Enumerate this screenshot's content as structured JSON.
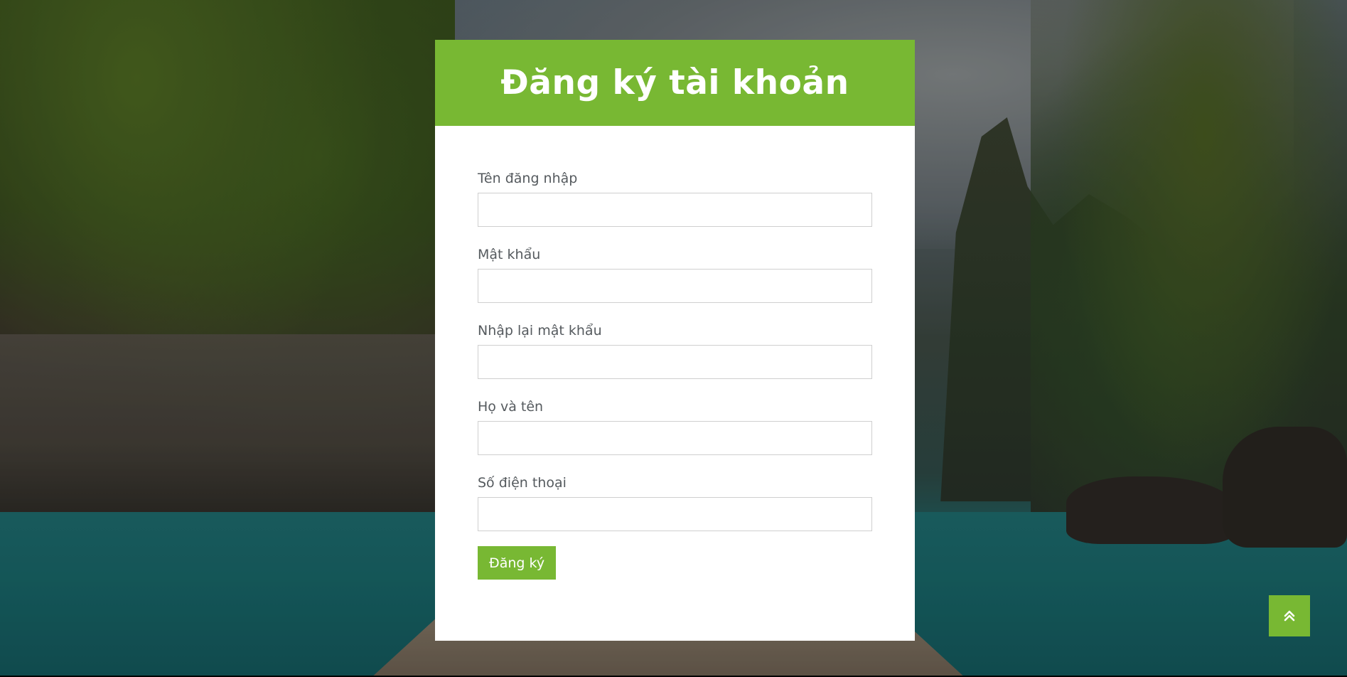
{
  "page": {
    "title": "Đăng ký tài khoản"
  },
  "form": {
    "fields": [
      {
        "label": "Tên đăng nhập",
        "value": "",
        "placeholder": ""
      },
      {
        "label": "Mật khẩu",
        "value": "",
        "placeholder": ""
      },
      {
        "label": "Nhập lại mật khẩu",
        "value": "",
        "placeholder": ""
      },
      {
        "label": "Họ và tên",
        "value": "",
        "placeholder": ""
      },
      {
        "label": "Số điện thoại",
        "value": "",
        "placeholder": ""
      }
    ],
    "submit_label": "Đăng ký"
  },
  "icons": {
    "back_to_top": "double-chevron-up-icon"
  },
  "colors": {
    "accent": "#78b833",
    "card_background": "#ffffff",
    "label_text": "#555a5e"
  }
}
